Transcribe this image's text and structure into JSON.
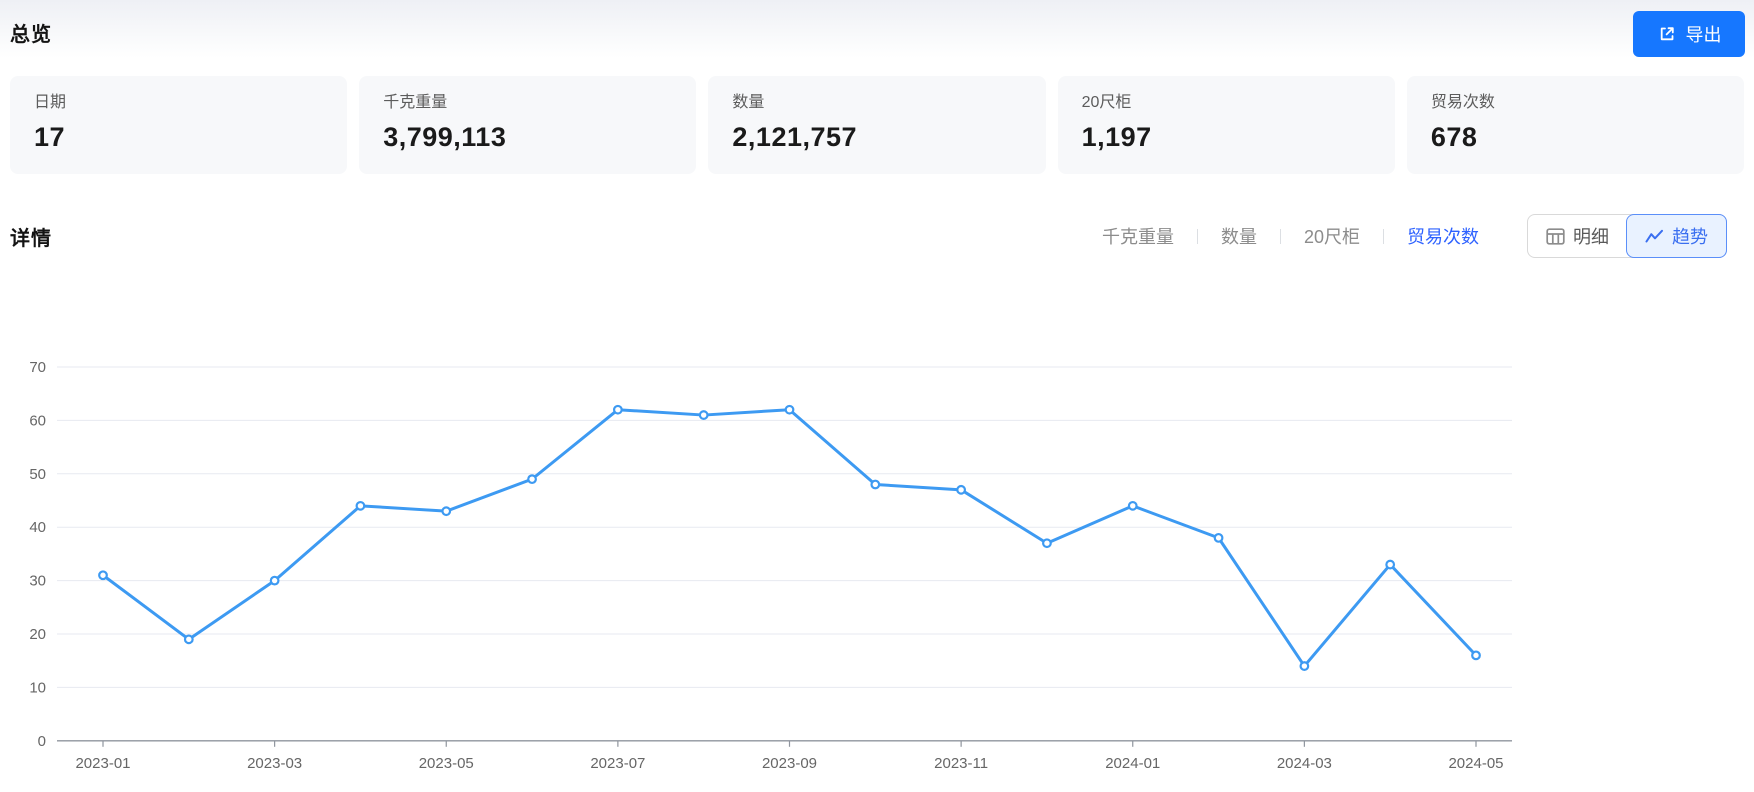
{
  "page": {
    "title": "总览",
    "details_title": "详情"
  },
  "header": {
    "export_label": "导出"
  },
  "stats": [
    {
      "label": "日期",
      "value": "17"
    },
    {
      "label": "千克重量",
      "value": "3,799,113"
    },
    {
      "label": "数量",
      "value": "2,121,757"
    },
    {
      "label": "20尺柜",
      "value": "1,197"
    },
    {
      "label": "贸易次数",
      "value": "678"
    }
  ],
  "detail_tabs": [
    {
      "label": "千克重量",
      "active": false
    },
    {
      "label": "数量",
      "active": false
    },
    {
      "label": "20尺柜",
      "active": false
    },
    {
      "label": "贸易次数",
      "active": true
    }
  ],
  "view_toggle": [
    {
      "label": "明细",
      "icon": "table-icon",
      "active": false
    },
    {
      "label": "趋势",
      "icon": "trend-icon",
      "active": true
    }
  ],
  "colors": {
    "export_button_bg": "#1677ff",
    "tab_active_blue": "#2e62ff",
    "toggle_active_bg": "#e9f2ff",
    "toggle_active_border": "#5b8ff9",
    "toggle_active_text": "#3a6ff0",
    "line_blue": "#3d9af2",
    "gridline": "#e7eaf1",
    "axis": "#8f959e",
    "tick_label": "#666666"
  },
  "chart_data": {
    "type": "line",
    "series_name": "贸易次数",
    "x": [
      "2023-01",
      "2023-02",
      "2023-03",
      "2023-04",
      "2023-05",
      "2023-06",
      "2023-07",
      "2023-08",
      "2023-09",
      "2023-10",
      "2023-11",
      "2023-12",
      "2024-01",
      "2024-02",
      "2024-03",
      "2024-04",
      "2024-05"
    ],
    "values": [
      31,
      19,
      30,
      44,
      43,
      49,
      62,
      61,
      62,
      48,
      47,
      37,
      44,
      38,
      14,
      33,
      16
    ],
    "visible_x_ticks": [
      "2023-01",
      "2023-03",
      "2023-05",
      "2023-07",
      "2023-09",
      "2023-11",
      "2024-01",
      "2024-03",
      "2024-05"
    ],
    "y_ticks": [
      0,
      10,
      20,
      30,
      40,
      50,
      60,
      70
    ],
    "ylim": [
      0,
      70
    ],
    "grid": true,
    "legend_position": "none",
    "line_color": "#3d9af2",
    "marker": "open-circle"
  }
}
